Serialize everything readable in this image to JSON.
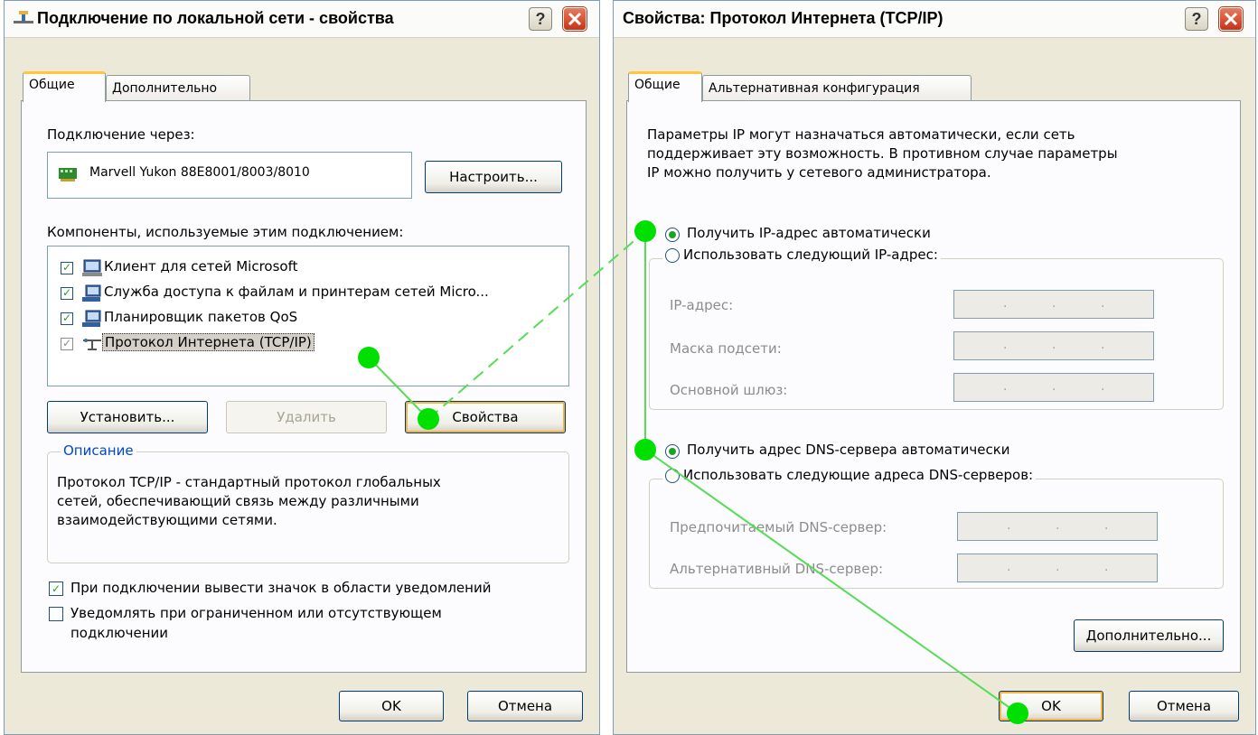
{
  "left_dialog": {
    "title": "Подключение по локальной сети - свойства",
    "help_label": "?",
    "tabs": [
      "Общие",
      "Дополнительно"
    ],
    "connect_via_label": "Подключение через:",
    "adapter_name": "Marvell Yukon 88E8001/8003/8010",
    "configure_button": "Настроить...",
    "components_label": "Компоненты, используемые этим подключением:",
    "components": [
      {
        "label": "Клиент для сетей Microsoft",
        "checked": true,
        "icon": "network-client-icon"
      },
      {
        "label": "Служба доступа к файлам и принтерам сетей Micro...",
        "checked": true,
        "icon": "file-printer-sharing-icon"
      },
      {
        "label": "Планировщик пакетов QoS",
        "checked": true,
        "icon": "qos-scheduler-icon"
      },
      {
        "label": "Протокол Интернета (TCP/IP)",
        "checked": true,
        "icon": "protocol-icon",
        "selected": true
      }
    ],
    "install_button": "Установить...",
    "remove_button": "Удалить",
    "properties_button": "Свойства",
    "description_legend": "Описание",
    "description_lines": [
      "Протокол TCP/IP - стандартный протокол глобальных",
      "сетей, обеспечивающий связь между различными",
      "взаимодействующими сетями."
    ],
    "show_icon_label": "При подключении вывести значок в области уведомлений",
    "show_icon_checked": true,
    "notify_line1": "Уведомлять при ограниченном или отсутствующем",
    "notify_line2": "подключении",
    "notify_checked": false,
    "ok_button": "OK",
    "cancel_button": "Отмена"
  },
  "right_dialog": {
    "title": "Свойства: Протокол Интернета (TCP/IP)",
    "help_label": "?",
    "tabs": [
      "Общие",
      "Альтернативная конфигурация"
    ],
    "intro_lines": [
      "Параметры IP могут назначаться автоматически, если сеть",
      "поддерживает эту возможность. В противном случае параметры",
      "IP можно получить у сетевого администратора."
    ],
    "ip_auto_label": "Получить IP-адрес автоматически",
    "ip_auto_selected": true,
    "ip_manual_label": "Использовать следующий IP-адрес:",
    "ip_address_label": "IP-адрес:",
    "subnet_label": "Маска подсети:",
    "gateway_label": "Основной шлюз:",
    "dns_auto_label": "Получить адрес DNS-сервера автоматически",
    "dns_auto_selected": true,
    "dns_manual_label": "Использовать следующие адреса DNS-серверов:",
    "preferred_dns_label": "Предпочитаемый DNS-сервер:",
    "alternate_dns_label": "Альтернативный DNS-сервер:",
    "ip_placeholder_dots": ".",
    "advanced_button": "Дополнительно...",
    "ok_button": "OK",
    "cancel_button": "Отмена"
  },
  "colors": {
    "dialog_bg": "#ece9d8",
    "panel_bg": "#fcfcfe",
    "accent_orange": "#ffc83c",
    "check_green": "#21a121",
    "annotation_green": "#00e000",
    "close_red": "#c5331a"
  }
}
